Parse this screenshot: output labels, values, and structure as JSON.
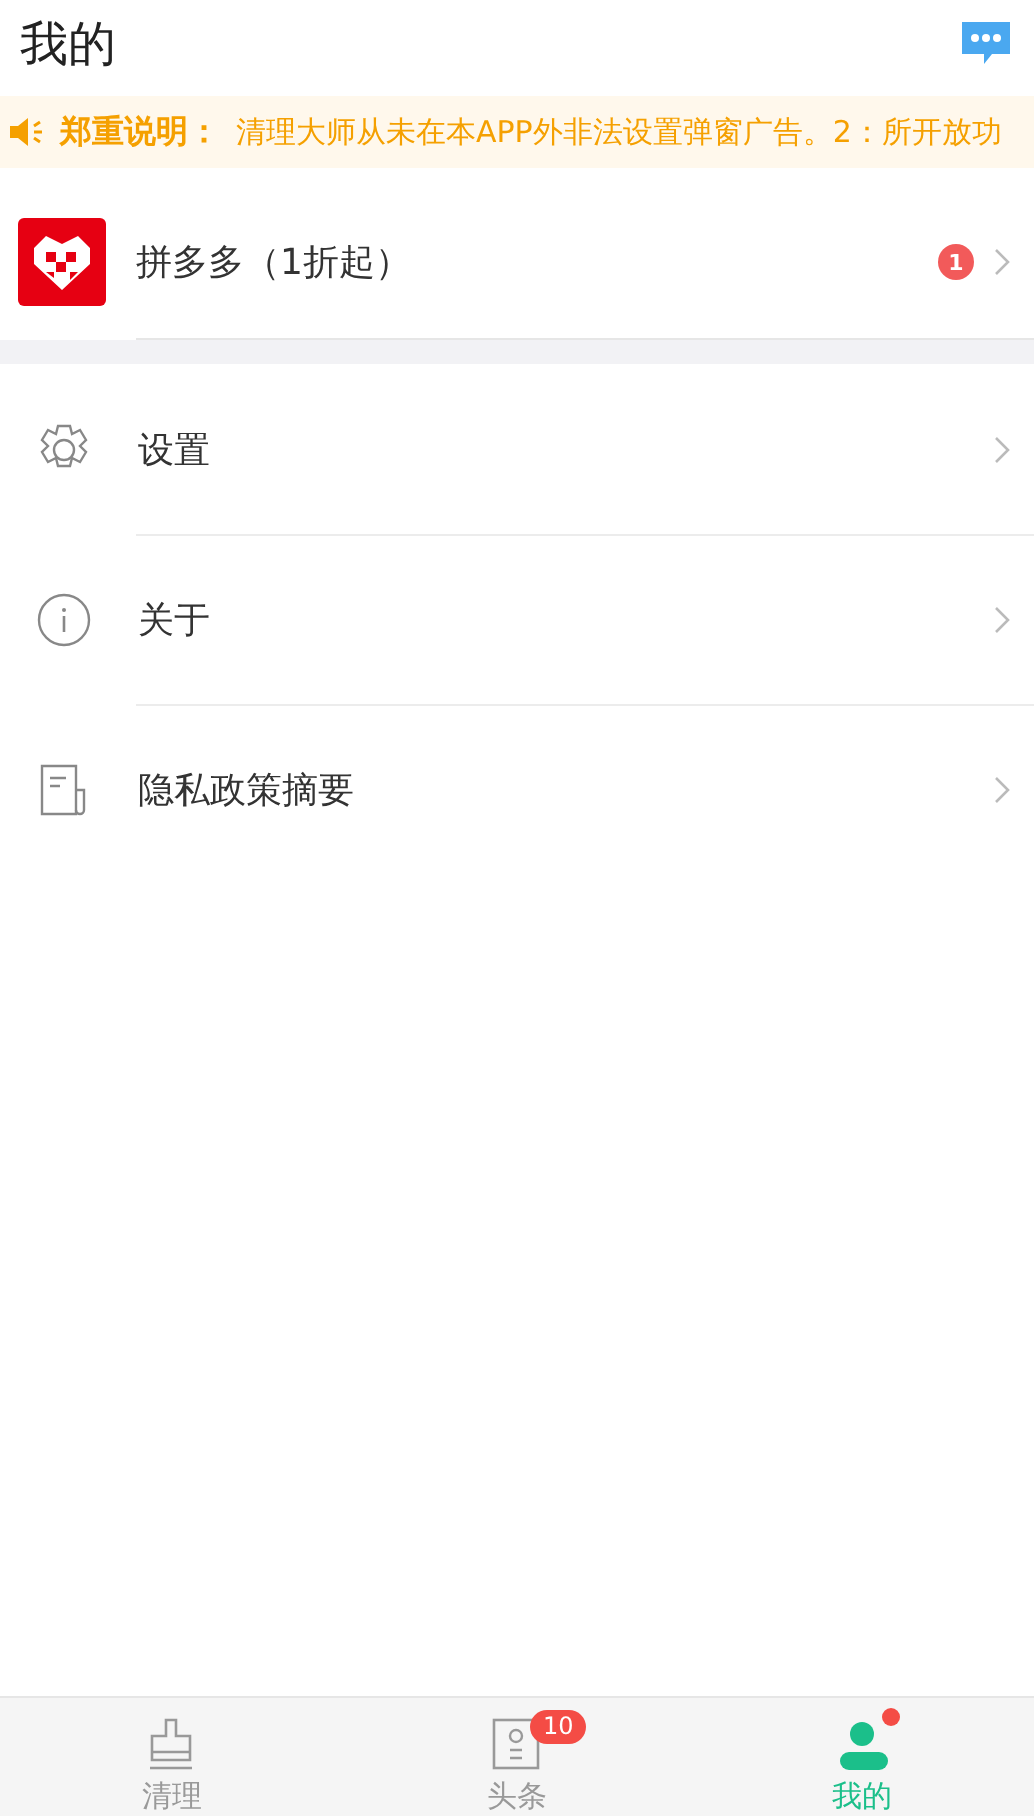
{
  "header": {
    "title": "我的"
  },
  "notice": {
    "label": "郑重说明：",
    "text": "清理大师从未在本APP外非法设置弹窗广告。2：所开放功"
  },
  "promo": {
    "label": "拼多多（1折起）",
    "badge": "1"
  },
  "menu": [
    {
      "label": "设置"
    },
    {
      "label": "关于"
    },
    {
      "label": "隐私政策摘要"
    }
  ],
  "tabbar": [
    {
      "label": "清理",
      "selected": false
    },
    {
      "label": "头条",
      "selected": false,
      "badge": "10"
    },
    {
      "label": "我的",
      "selected": true,
      "dot": true
    }
  ]
}
